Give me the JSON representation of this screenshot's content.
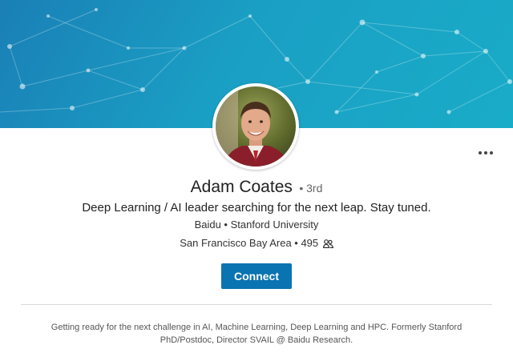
{
  "profile": {
    "name": "Adam Coates",
    "degree": "• 3rd",
    "headline": "Deep Learning / AI leader searching for the next leap. Stay tuned.",
    "org": "Baidu • Stanford University",
    "location": "San Francisco Bay Area • 495",
    "connections_icon": "people-icon",
    "avatar": "profile-photo",
    "more_icon": "more-options-icon"
  },
  "actions": {
    "connect_label": "Connect"
  },
  "summary": {
    "text": "Getting ready for the next challenge in AI, Machine Learning, Deep Learning and HPC. Formerly Stanford PhD/Postdoc, Director SVAIL @ Baidu Research."
  },
  "colors": {
    "banner_start": "#1a7fb6",
    "banner_end": "#19acc8",
    "connect_button": "#0a73b1"
  }
}
